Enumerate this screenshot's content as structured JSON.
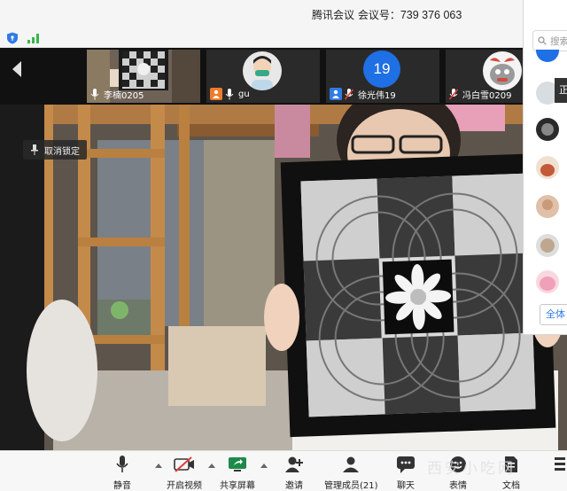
{
  "window": {
    "title_prefix": "腾讯会议 会议号：",
    "meeting_id": "739 376 063"
  },
  "thumbnails": [
    {
      "name": "李楠0205",
      "mic": "on"
    },
    {
      "name": "gu",
      "mic": "on"
    },
    {
      "name": "徐光伟19",
      "mic": "muted",
      "avatar_text": "19"
    },
    {
      "name": "冯白雪0209",
      "mic": "muted"
    }
  ],
  "video": {
    "unpin_label": "取消锁定"
  },
  "panel": {
    "search_placeholder": "搜索",
    "tooltip_text": "正",
    "all_button_label": "全体"
  },
  "toolbar": {
    "mute_label": "静音",
    "video_label": "开启视频",
    "share_label": "共享屏幕",
    "invite_label": "邀请",
    "members_label": "管理成员(21)",
    "chat_label": "聊天",
    "reaction_label": "表情",
    "docs_label": "文档"
  },
  "watermark": "西安小吃网",
  "colors": {
    "accent_blue": "#1f6fe5",
    "muted_red": "#e03c3c",
    "signal_green": "#3cb44b"
  }
}
